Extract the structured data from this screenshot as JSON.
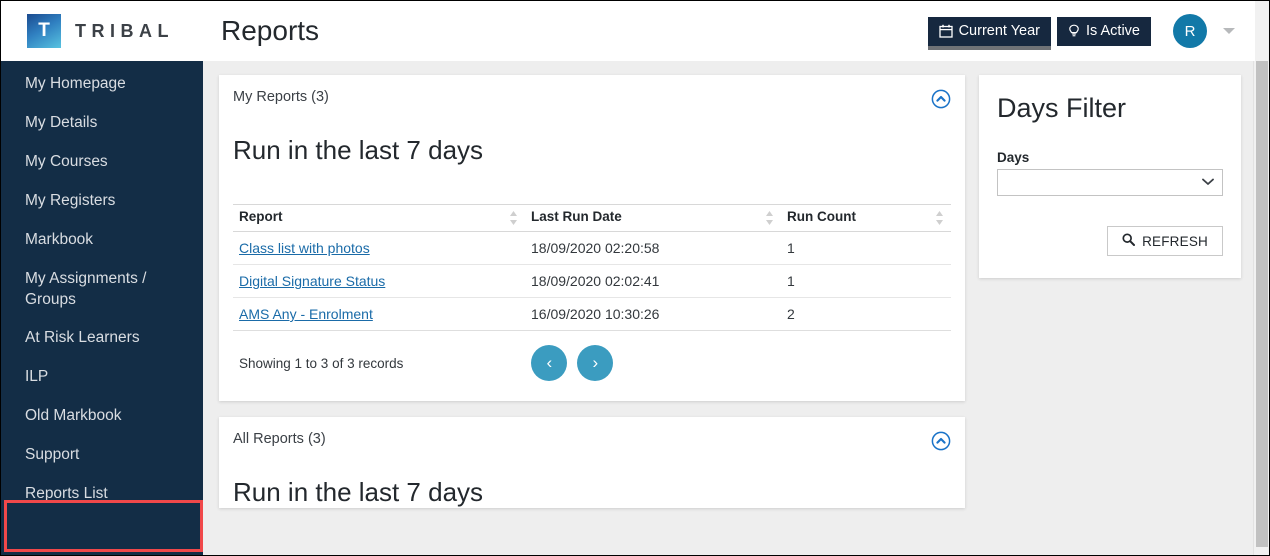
{
  "brand": {
    "mark_letter": "T",
    "wordmark": "TRIBAL",
    "logo_icon": "tribal-logo-icon"
  },
  "header": {
    "page_title": "Reports",
    "context_buttons": [
      {
        "label": "Current Year",
        "icon": "calendar-icon",
        "active": true
      },
      {
        "label": "Is Active",
        "icon": "lightbulb-icon",
        "active": false
      }
    ],
    "avatar_initial": "R",
    "caret_icon": "caret-down-icon"
  },
  "sidebar": {
    "items": [
      {
        "label": "My Homepage",
        "highlighted": false
      },
      {
        "label": "My Details",
        "highlighted": false
      },
      {
        "label": "My Courses",
        "highlighted": false
      },
      {
        "label": "My Registers",
        "highlighted": false
      },
      {
        "label": "Markbook",
        "highlighted": false
      },
      {
        "label": "My Assignments /\nGroups",
        "highlighted": false
      },
      {
        "label": "At Risk Learners",
        "highlighted": false
      },
      {
        "label": "ILP",
        "highlighted": false
      },
      {
        "label": "Old Markbook",
        "highlighted": false
      },
      {
        "label": "Support",
        "highlighted": false
      },
      {
        "label": "Reports List",
        "highlighted": true
      }
    ]
  },
  "my_reports_card": {
    "eyebrow": "My Reports (3)",
    "title": "Run in the last 7 days",
    "collapse_icon": "chevron-up-circle-icon",
    "columns": [
      "Report",
      "Last Run Date",
      "Run Count"
    ],
    "rows": [
      {
        "report": "Class list with photos",
        "last_run_date": "18/09/2020 02:20:58",
        "run_count": "1"
      },
      {
        "report": "Digital Signature Status",
        "last_run_date": "18/09/2020 02:02:41",
        "run_count": "1"
      },
      {
        "report": "AMS Any - Enrolment",
        "last_run_date": "16/09/2020 10:30:26",
        "run_count": "2"
      }
    ],
    "records_text": "Showing 1 to 3 of 3 records",
    "prev_icon": "chevron-left-icon",
    "next_icon": "chevron-right-icon"
  },
  "all_reports_card": {
    "eyebrow": "All Reports (3)",
    "title": "Run in the last 7 days",
    "collapse_icon": "chevron-up-circle-icon"
  },
  "days_filter": {
    "title": "Days Filter",
    "field_label": "Days",
    "selected_value": "",
    "options": [
      ""
    ],
    "refresh_label": "REFRESH",
    "refresh_icon": "search-icon",
    "dropdown_icon": "chevron-down-icon"
  },
  "colors": {
    "sidebar_bg": "#132d46",
    "context_btn_bg": "#16283f",
    "accent_teal": "#3b9cc0",
    "avatar_bg": "#1279a8",
    "link_blue": "#1a6ba8",
    "highlight_red": "#f0484a",
    "content_bg": "#eeeeee"
  }
}
